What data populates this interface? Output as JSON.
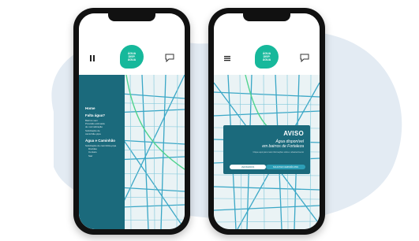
{
  "colors": {
    "brand": "#16b89b",
    "drawer": "#1b6a7c",
    "map_road": "#3aa7c6",
    "blob": "#e3ebf3"
  },
  "logo": {
    "line1": "ÁGUA",
    "line2": "DISP.",
    "line3": "ÁGUA"
  },
  "drawer": {
    "section1": "Home",
    "section2": "Falta água?",
    "items2": [
      "Bairros sem",
      "Previsão estimada",
      "de normalização",
      "Solicitação de",
      "caminhão-pipa"
    ],
    "section3": "Água e Caminhão",
    "items3": [
      "Solicitação de caminhão-pipa",
      "Dúvidas",
      "Contato",
      "Sair"
    ]
  },
  "modal": {
    "title": "AVISO",
    "message_line1": "Água disponível",
    "message_line2": "em bairros de Fortaleza",
    "hint": "Clique aqui para mais informações sobre o abastecimento",
    "button_left": "VER BAIRROS",
    "button_right": "SOLICITAR CAMINHÃO-PIPA"
  },
  "icons": {
    "menu": "menu-icon",
    "chat": "chat-icon",
    "pause": "pause-icon"
  }
}
